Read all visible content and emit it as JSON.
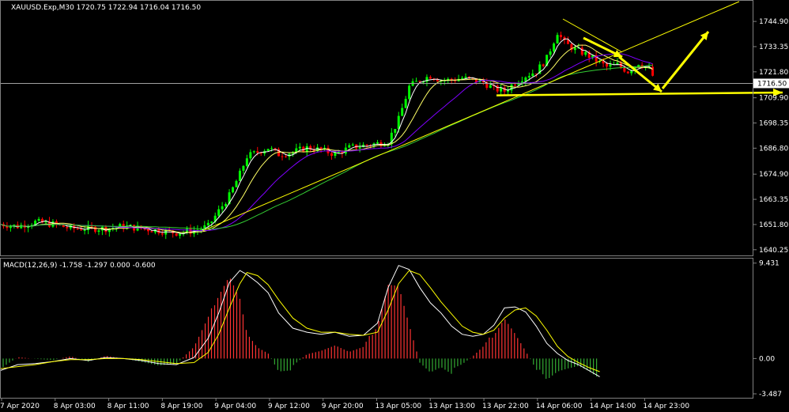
{
  "header": {
    "symbol_line": "XAUUSD.Exp,M30  1720.75 1722.94 1716.04 1716.50"
  },
  "macd_header": {
    "label": "MACD(12,26,9) -1.758 -1.297 0.000 -0.600"
  },
  "colors": {
    "background": "#000000",
    "bull": "#00ff00",
    "bear": "#ff0000",
    "ma_fast": "#ffffff",
    "ma_mid": "#ffff66",
    "ma_slow": "#7f00ff",
    "ma_long": "#33cc33",
    "trend": "#ffff00",
    "hist_pos": "#ff3333",
    "hist_neg": "#33aa33",
    "macd_line": "#ffffff",
    "signal_line": "#ffff00",
    "current_price_line": "#a0a0a0"
  },
  "chart_data": [
    {
      "type": "candlestick",
      "symbol": "XAUUSD.Exp",
      "timeframe": "M30",
      "ylim": [
        1638.0,
        1754.0
      ],
      "y_ticks": [
        "1744.90",
        "1733.35",
        "1721.80",
        "1709.90",
        "1698.35",
        "1686.80",
        "1674.90",
        "1663.35",
        "1651.80",
        "1640.25"
      ],
      "y_tick_values": [
        1744.9,
        1733.35,
        1721.8,
        1709.9,
        1698.35,
        1686.8,
        1674.9,
        1663.35,
        1651.8,
        1640.25
      ],
      "x_ticks": [
        "7 Apr 2020",
        "8 Apr 03:00",
        "8 Apr 11:00",
        "8 Apr 19:00",
        "9 Apr 04:00",
        "9 Apr 12:00",
        "9 Apr 20:00",
        "13 Apr 05:00",
        "13 Apr 13:00",
        "13 Apr 22:00",
        "14 Apr 06:00",
        "14 Apr 14:00",
        "14 Apr 23:00"
      ],
      "price_trend_points": [
        [
          0,
          1652
        ],
        [
          10,
          1651
        ],
        [
          20,
          1653
        ],
        [
          30,
          1652
        ],
        [
          40,
          1650
        ],
        [
          50,
          1650
        ],
        [
          60,
          1650
        ],
        [
          70,
          1651
        ],
        [
          80,
          1650
        ],
        [
          90,
          1649
        ],
        [
          100,
          1648
        ],
        [
          110,
          1649
        ],
        [
          118,
          1651
        ],
        [
          124,
          1658
        ],
        [
          130,
          1665
        ],
        [
          136,
          1675
        ],
        [
          140,
          1683
        ],
        [
          146,
          1685
        ],
        [
          152,
          1687
        ],
        [
          158,
          1684
        ],
        [
          166,
          1685
        ],
        [
          174,
          1687
        ],
        [
          182,
          1686
        ],
        [
          190,
          1684
        ],
        [
          198,
          1687
        ],
        [
          206,
          1688
        ],
        [
          214,
          1689
        ],
        [
          220,
          1690
        ],
        [
          226,
          1700
        ],
        [
          232,
          1715
        ],
        [
          238,
          1718
        ],
        [
          244,
          1720
        ],
        [
          250,
          1718
        ],
        [
          256,
          1718
        ],
        [
          262,
          1719
        ],
        [
          268,
          1718
        ],
        [
          274,
          1717
        ],
        [
          280,
          1714
        ],
        [
          286,
          1713
        ],
        [
          292,
          1717
        ],
        [
          298,
          1720
        ],
        [
          304,
          1722
        ],
        [
          310,
          1728
        ],
        [
          316,
          1740
        ],
        [
          320,
          1735
        ],
        [
          326,
          1732
        ],
        [
          332,
          1730
        ],
        [
          338,
          1727
        ],
        [
          344,
          1724
        ],
        [
          350,
          1725
        ],
        [
          356,
          1722
        ],
        [
          362,
          1726
        ],
        [
          368,
          1723
        ],
        [
          372,
          1717
        ]
      ],
      "current_price": 1716.5,
      "current_price_label": "1716.50",
      "projection_arrows": [
        {
          "from": [
            1741,
            1736
          ],
          "to": [
            1713,
            1713
          ],
          "note": ""
        }
      ]
    },
    {
      "type": "line",
      "name": "MACD(12,26,9)",
      "ylim": [
        -3.8,
        9.8
      ],
      "y_ticks": [
        "9.431",
        "0.00",
        "-3.487"
      ],
      "y_tick_values": [
        9.431,
        0.0,
        -3.487
      ],
      "macd_points": [
        [
          0,
          -1.2
        ],
        [
          10,
          -0.6
        ],
        [
          20,
          -0.5
        ],
        [
          30,
          -0.3
        ],
        [
          40,
          0.0
        ],
        [
          50,
          -0.2
        ],
        [
          60,
          0.1
        ],
        [
          70,
          0.0
        ],
        [
          80,
          -0.2
        ],
        [
          90,
          -0.5
        ],
        [
          100,
          -0.6
        ],
        [
          110,
          0.1
        ],
        [
          118,
          2.0
        ],
        [
          124,
          4.5
        ],
        [
          130,
          7.5
        ],
        [
          136,
          8.7
        ],
        [
          140,
          8.3
        ],
        [
          146,
          7.5
        ],
        [
          152,
          6.5
        ],
        [
          158,
          4.5
        ],
        [
          166,
          3.0
        ],
        [
          174,
          2.6
        ],
        [
          182,
          2.4
        ],
        [
          190,
          2.6
        ],
        [
          198,
          2.2
        ],
        [
          206,
          2.3
        ],
        [
          214,
          3.5
        ],
        [
          220,
          7.0
        ],
        [
          226,
          9.2
        ],
        [
          232,
          8.8
        ],
        [
          238,
          7.0
        ],
        [
          244,
          5.5
        ],
        [
          250,
          4.5
        ],
        [
          256,
          3.2
        ],
        [
          262,
          2.4
        ],
        [
          268,
          2.2
        ],
        [
          274,
          2.4
        ],
        [
          280,
          3.3
        ],
        [
          286,
          5.0
        ],
        [
          292,
          5.1
        ],
        [
          298,
          4.6
        ],
        [
          304,
          3.2
        ],
        [
          310,
          1.5
        ],
        [
          316,
          0.5
        ],
        [
          322,
          -0.2
        ],
        [
          328,
          -0.6
        ],
        [
          334,
          -1.2
        ],
        [
          340,
          -1.8
        ]
      ],
      "signal_points": [
        [
          0,
          -1.0
        ],
        [
          10,
          -0.8
        ],
        [
          20,
          -0.6
        ],
        [
          30,
          -0.3
        ],
        [
          40,
          -0.1
        ],
        [
          50,
          -0.1
        ],
        [
          60,
          0.0
        ],
        [
          70,
          0.0
        ],
        [
          80,
          -0.1
        ],
        [
          90,
          -0.3
        ],
        [
          100,
          -0.5
        ],
        [
          110,
          -0.4
        ],
        [
          118,
          0.6
        ],
        [
          124,
          2.4
        ],
        [
          130,
          5.0
        ],
        [
          136,
          7.4
        ],
        [
          140,
          8.5
        ],
        [
          146,
          8.2
        ],
        [
          152,
          7.3
        ],
        [
          158,
          5.8
        ],
        [
          166,
          4.0
        ],
        [
          174,
          3.0
        ],
        [
          182,
          2.6
        ],
        [
          190,
          2.6
        ],
        [
          198,
          2.4
        ],
        [
          206,
          2.3
        ],
        [
          214,
          2.6
        ],
        [
          220,
          4.8
        ],
        [
          226,
          7.4
        ],
        [
          232,
          8.7
        ],
        [
          238,
          8.3
        ],
        [
          244,
          7.0
        ],
        [
          250,
          5.6
        ],
        [
          256,
          4.4
        ],
        [
          262,
          3.2
        ],
        [
          268,
          2.6
        ],
        [
          274,
          2.4
        ],
        [
          280,
          2.8
        ],
        [
          286,
          4.0
        ],
        [
          292,
          4.8
        ],
        [
          298,
          5.0
        ],
        [
          304,
          4.2
        ],
        [
          310,
          2.8
        ],
        [
          316,
          1.2
        ],
        [
          322,
          0.2
        ],
        [
          328,
          -0.4
        ],
        [
          334,
          -0.9
        ],
        [
          340,
          -1.3
        ]
      ]
    }
  ]
}
